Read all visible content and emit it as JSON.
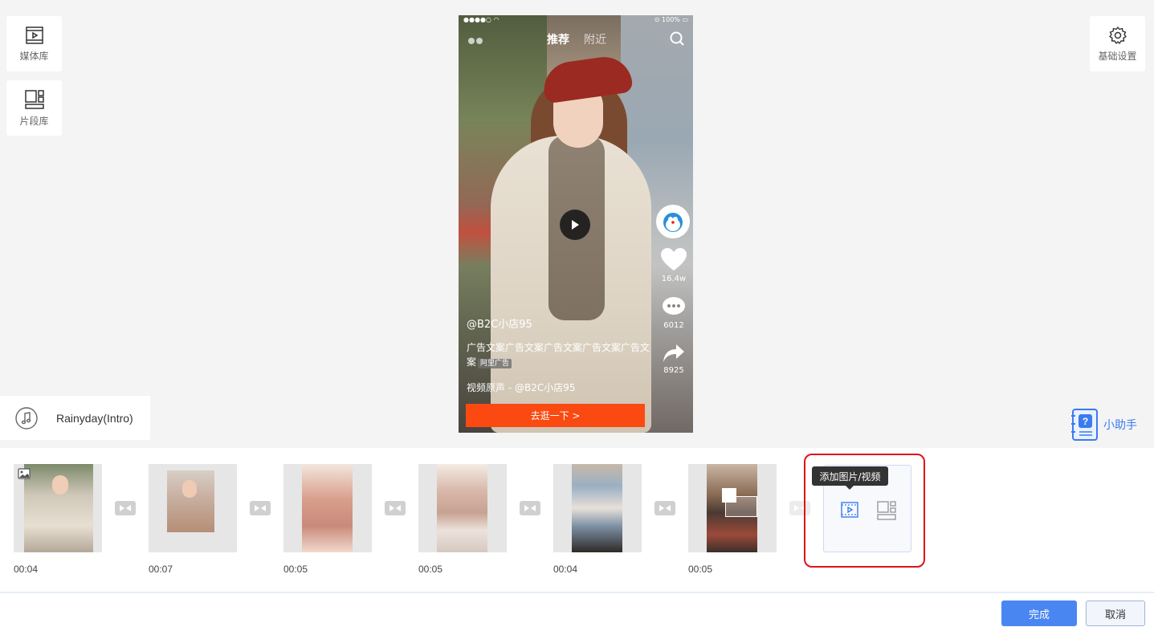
{
  "sidebar": {
    "media_library": {
      "label": "媒体库",
      "icon": "video-library-icon"
    },
    "clip_library": {
      "label": "片段库",
      "icon": "layout-blocks-icon"
    }
  },
  "settings": {
    "label": "基础设置",
    "icon": "gear-icon"
  },
  "music": {
    "name": "Rainyday(Intro)",
    "icon": "music-note-icon"
  },
  "assistant": {
    "label": "小助手",
    "icon": "help-book-icon"
  },
  "preview": {
    "status_battery": "100%",
    "tabs": [
      "推荐",
      "附近"
    ],
    "likes": "16.4w",
    "comments": "6012",
    "shares": "8925",
    "author": "@B2C小店95",
    "description": "广告文案广告文案广告文案广告文案广告文案",
    "ad_tag": "阿里广告",
    "music_line": "视频原声 - @B2C小店95",
    "cta": "去逛一下 >"
  },
  "timeline": {
    "clips": [
      {
        "time": "00:04"
      },
      {
        "time": "00:07"
      },
      {
        "time": "00:05"
      },
      {
        "time": "00:05"
      },
      {
        "time": "00:04"
      },
      {
        "time": "00:05"
      }
    ],
    "add_tooltip": "添加图片/视频"
  },
  "actions": {
    "confirm": "完成",
    "cancel": "取消"
  },
  "colors": {
    "accent": "#4a86f2",
    "cta": "#fa4a12",
    "highlight": "#e0121b"
  }
}
